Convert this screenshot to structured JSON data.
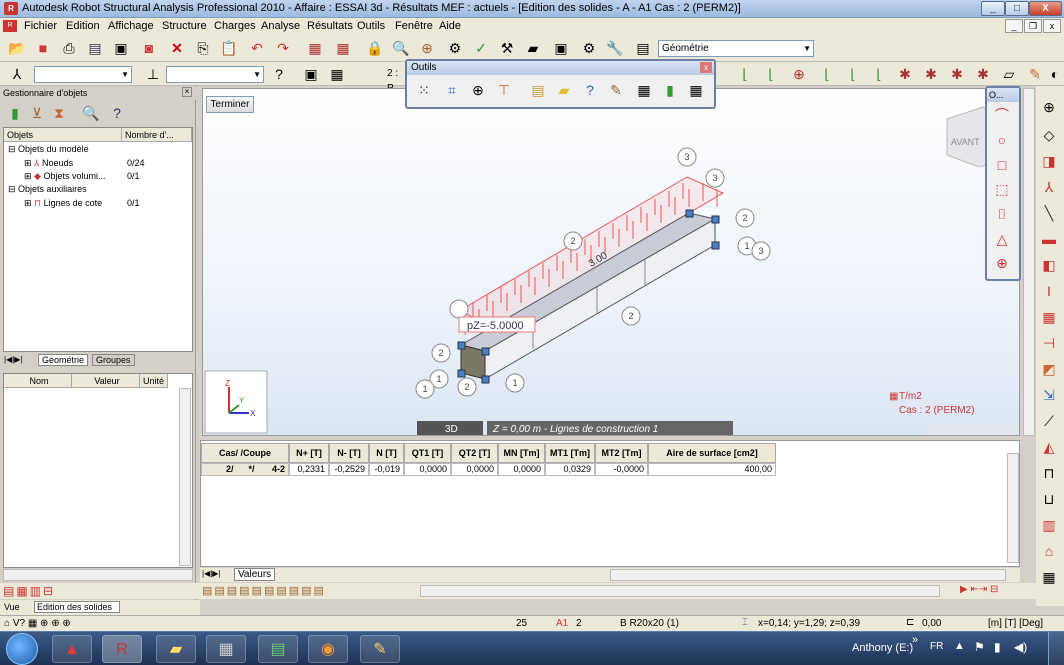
{
  "window": {
    "title": "Autodesk Robot Structural Analysis Professional 2010 - Affaire : ESSAI 3d - Résultats MEF : actuels - [Edition des solides -  A - A1 Cas : 2 (PERM2)]",
    "min": "_",
    "max": "□",
    "close": "X"
  },
  "menu": {
    "items": [
      "Fichier",
      "Edition",
      "Affichage",
      "Structure",
      "Charges",
      "Analyse",
      "Résultats",
      "Outils",
      "Fenêtre",
      "Aide"
    ],
    "mdi_min": "_",
    "mdi_restore": "❐",
    "mdi_close": "x"
  },
  "toolbar1": {
    "layout_combo": "Géométrie"
  },
  "toolbar2": {
    "combo1": "",
    "combo2": "",
    "num_field": "2 : P"
  },
  "outils": {
    "title": "Outils",
    "close": "x"
  },
  "shapes_palette": {
    "title": "O..."
  },
  "object_manager": {
    "title": "Gestionnaire d'objets",
    "col_objets": "Objets",
    "col_nombre": "Nombre d'...",
    "tree": [
      {
        "label": "Objets du modèle",
        "count": ""
      },
      {
        "label": "Noeuds",
        "count": "0/24"
      },
      {
        "label": "Objets volumi...",
        "count": "0/1"
      },
      {
        "label": "Objets auxiliaires",
        "count": ""
      },
      {
        "label": "Lignes de cote",
        "count": "0/1"
      }
    ],
    "tab_geometrie": "Géométrie",
    "tab_groupes": "Groupes"
  },
  "properties": {
    "col_nom": "Nom",
    "col_valeur": "Valeur",
    "col_unite": "Unité"
  },
  "viewport": {
    "terminer_button": "Terminer",
    "load_label": "pZ=-5.0000",
    "dim_label": "3.00",
    "units": "T/m2",
    "case": "Cas : 2 (PERM2)",
    "mode_3d": "3D",
    "construction_line": "Z = 0,00 m - Lignes de construction 1",
    "view_cube": "AVANT",
    "axis_z": "Z",
    "axis_y": "Y",
    "axis_x": "X",
    "node_labels": [
      "1",
      "1",
      "2",
      "2",
      "1",
      "1",
      "2",
      "3",
      "3",
      "2",
      "2",
      "2",
      "1",
      "3"
    ]
  },
  "results_table": {
    "headers": [
      "Cas/ /Coupe",
      "N+ [T]",
      "N- [T]",
      "N [T]",
      "QT1 [T]",
      "QT2 [T]",
      "MN [Tm]",
      "MT1 [Tm]",
      "MT2 [Tm]",
      "Aire de surface [cm2]"
    ],
    "row": [
      "2/      */       4-2",
      "0,2331",
      "-0,2529",
      "-0,019",
      "0,0000",
      "0,0000",
      "0,0000",
      "0,0329",
      "-0,0000",
      "400,00"
    ],
    "tab": "Valeurs"
  },
  "bottom": {
    "vue_label": "Vue",
    "edition_field": "Edition des solides"
  },
  "status": {
    "field1": "25",
    "field2": "2",
    "section": "B R20x20 (1)",
    "coords": "x=0,14; y=1,29; z=0,39",
    "value": "0,00",
    "units": "[m] [T] [Deg]"
  },
  "taskbar": {
    "user": "Anthony (E:)",
    "lang": "FR",
    "chevron": "»"
  }
}
